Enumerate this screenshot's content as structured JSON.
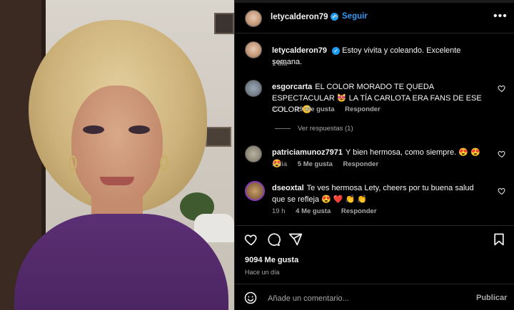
{
  "header": {
    "username": "letycalderon79",
    "follow_label": "Seguir",
    "separator": "•",
    "more": "•••"
  },
  "caption": {
    "username": "letycalderon79",
    "text": "Estoy vivita y coleando. Excelente semana.",
    "time": "1 día"
  },
  "comments": [
    {
      "username": "esgorcarta",
      "text": "EL COLOR MORADO TE QUEDA ESPECTACULAR 😻 LA TÍA CARLOTA ERA FANS DE ESE COLOR 😊",
      "time": "22 h",
      "likes": "19 Me gusta",
      "reply": "Responder",
      "view_replies": "Ver respuestas (1)"
    },
    {
      "username": "patriciamunoz7971",
      "text": "Y bien hermosa, como siempre. 😍 😍 😍",
      "time": "1 día",
      "likes": "5 Me gusta",
      "reply": "Responder"
    },
    {
      "username": "dseoxtal",
      "text": "Te ves hermosa Lety, cheers por tu buena salud que se refleja 😍 ❤️ 👏 👏",
      "time": "19 h",
      "likes": "4 Me gusta",
      "reply": "Responder"
    }
  ],
  "footer": {
    "likes": "9094 Me gusta",
    "time": "Hace un día",
    "comment_placeholder": "Añade un comentario...",
    "publish_label": "Publicar"
  },
  "colors": {
    "accent": "#3897f0",
    "verified": "#1d9bf0",
    "background": "#000000",
    "muted_text": "#a8a8a8"
  },
  "icons": [
    "verified-icon",
    "more-icon",
    "heart-icon",
    "comment-icon",
    "share-icon",
    "bookmark-icon",
    "emoji-icon"
  ]
}
